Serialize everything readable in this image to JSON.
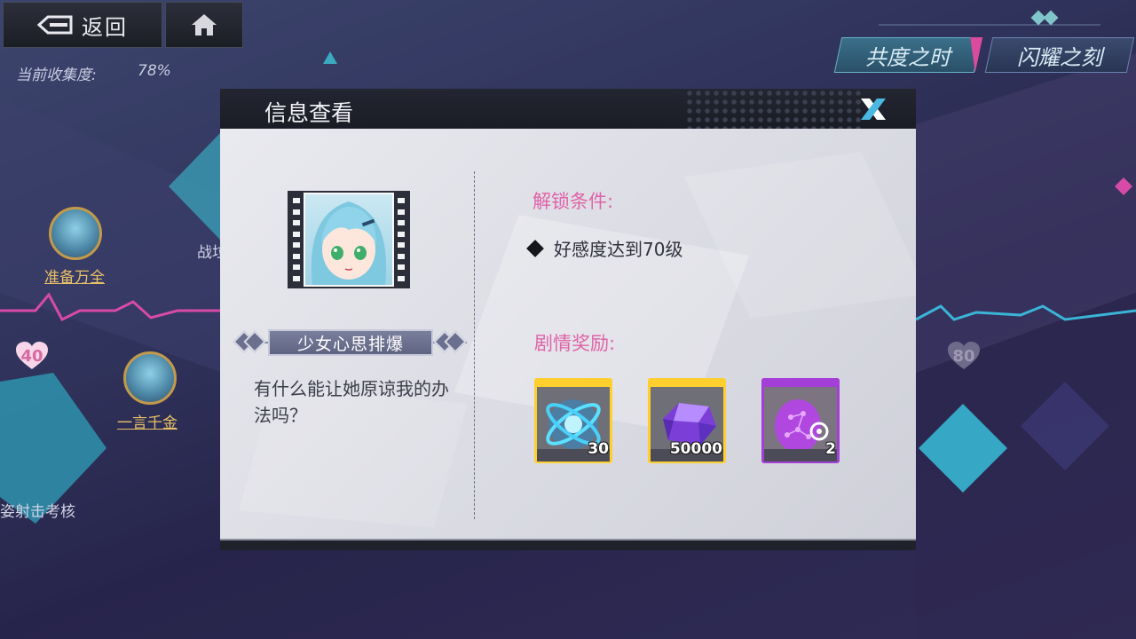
{
  "nav": {
    "back_label": "返回",
    "collection_label": "当前收集度:",
    "collection_value": "78%"
  },
  "tabs": [
    {
      "label": "共度之时"
    },
    {
      "label": "闪耀之刻"
    }
  ],
  "background": {
    "nodes": [
      {
        "label": "准备万全"
      },
      {
        "label": "一言千金"
      }
    ],
    "heart_left": "40",
    "heart_right": "80",
    "partial_text_left": "姿射击考核",
    "partial_text_top": "战垃"
  },
  "modal": {
    "title": "信息查看",
    "story_title": "少女心思排爆",
    "story_description": "有什么能让她原谅我的办法吗？",
    "unlock_heading": "解锁条件:",
    "unlock_condition": "好感度达到70级",
    "reward_heading": "剧情奖励:",
    "rewards": [
      {
        "count": "30",
        "rarity": "gold",
        "icon": "blue-crystal-orb-icon"
      },
      {
        "count": "50000",
        "rarity": "gold",
        "icon": "purple-gem-icon"
      },
      {
        "count": "2",
        "rarity": "purple",
        "icon": "purple-headset-chip-icon"
      }
    ]
  },
  "colors": {
    "accent_pink": "#e062a8",
    "rarity_gold": "#ffcf2e",
    "rarity_purple": "#a33ed6"
  }
}
